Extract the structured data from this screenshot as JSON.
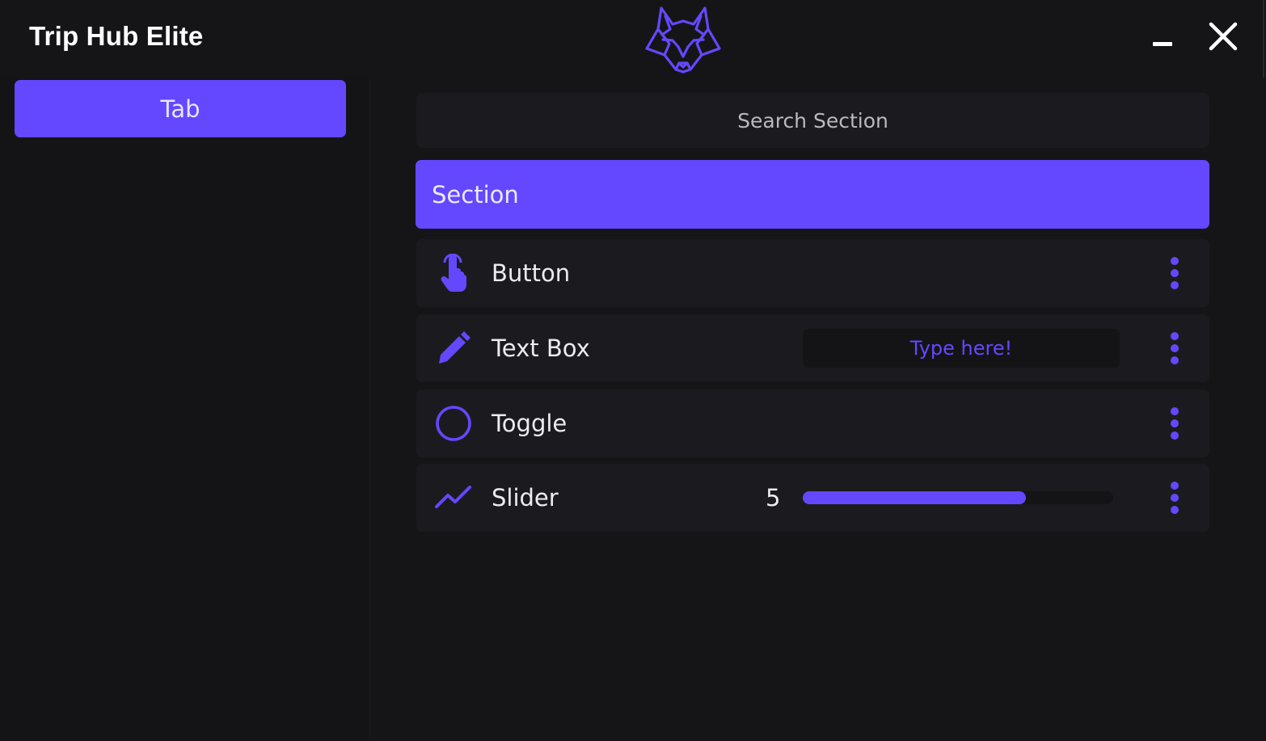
{
  "app": {
    "title": "Trip Hub Elite",
    "logo_icon": "fox-head-icon",
    "accent_color": "#6448ff"
  },
  "window_controls": {
    "minimize_icon": "minimize-icon",
    "close_icon": "close-icon"
  },
  "sidebar": {
    "tabs": [
      {
        "label": "Tab",
        "selected": true
      }
    ]
  },
  "main": {
    "search": {
      "placeholder": "Search Section",
      "value": ""
    },
    "section": {
      "label": "Section"
    },
    "elements": [
      {
        "type": "button",
        "label": "Button",
        "icon": "pointer-hand-icon",
        "menu_icon": "more-vertical-icon"
      },
      {
        "type": "textbox",
        "label": "Text Box",
        "icon": "pencil-icon",
        "placeholder": "Type here!",
        "value": "",
        "menu_icon": "more-vertical-icon"
      },
      {
        "type": "toggle",
        "label": "Toggle",
        "icon": "circle-icon",
        "state": false,
        "menu_icon": "more-vertical-icon"
      },
      {
        "type": "slider",
        "label": "Slider",
        "icon": "trending-line-icon",
        "value": "5",
        "fill_fraction": 0.72,
        "menu_icon": "more-vertical-icon"
      }
    ]
  }
}
